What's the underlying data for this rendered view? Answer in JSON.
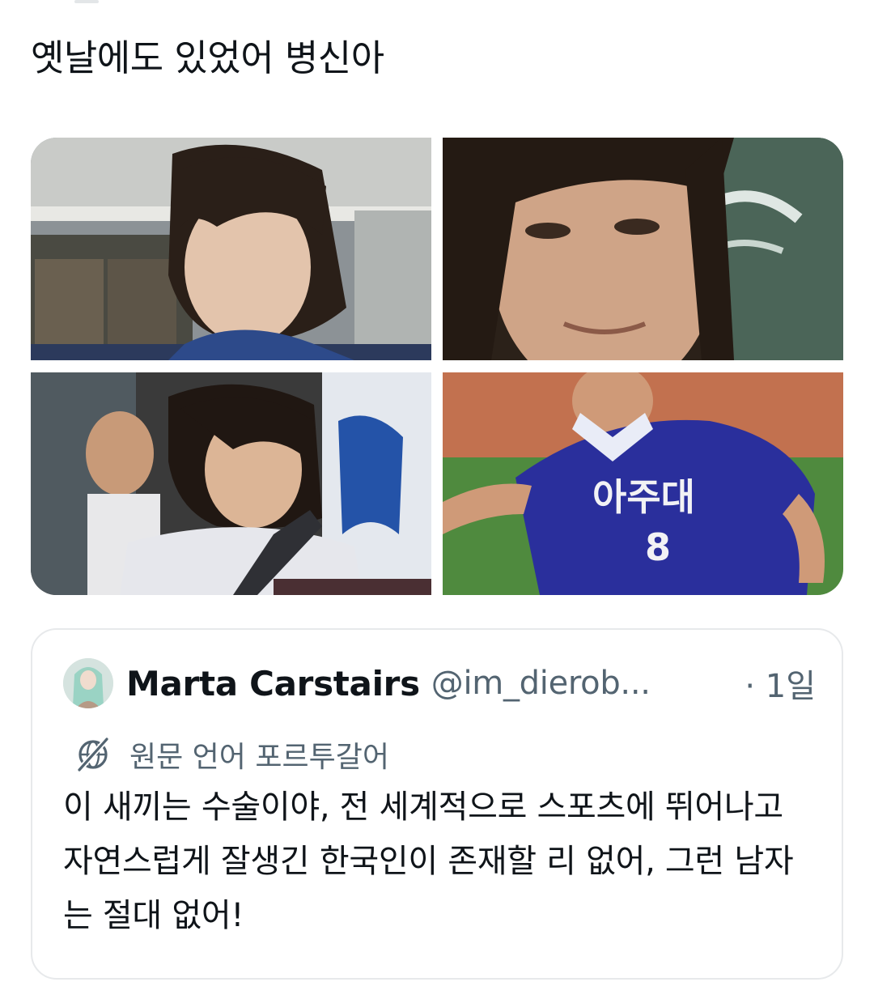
{
  "tweet": {
    "text": "옛날에도 있었어 병신아"
  },
  "media": {
    "photos": [
      {
        "name": "long-haired man in stadium"
      },
      {
        "name": "long-haired man close-up"
      },
      {
        "name": "man in white t-shirt with backpack strap"
      },
      {
        "name": "football player in blue jersey"
      }
    ],
    "jersey_text": "아주대",
    "jersey_number": "8"
  },
  "quote": {
    "display_name": "Marta Carstairs",
    "handle": "@im_dierob...",
    "time": "· 1일",
    "translate_label": "원문 언어 포르투갈어",
    "body": "이 새끼는 수술이야, 전 세계적으로 스포츠에 뛰어나고 자연스럽게 잘생긴 한국인이 존재할 리 없어, 그런 남자는 절대 없어!"
  },
  "colors": {
    "text_primary": "#0f1419",
    "text_secondary": "#536471",
    "border": "#e7e9eb",
    "jersey_blue": "#2a2f9c"
  },
  "icons": {
    "translate": "globe-slash-icon"
  }
}
